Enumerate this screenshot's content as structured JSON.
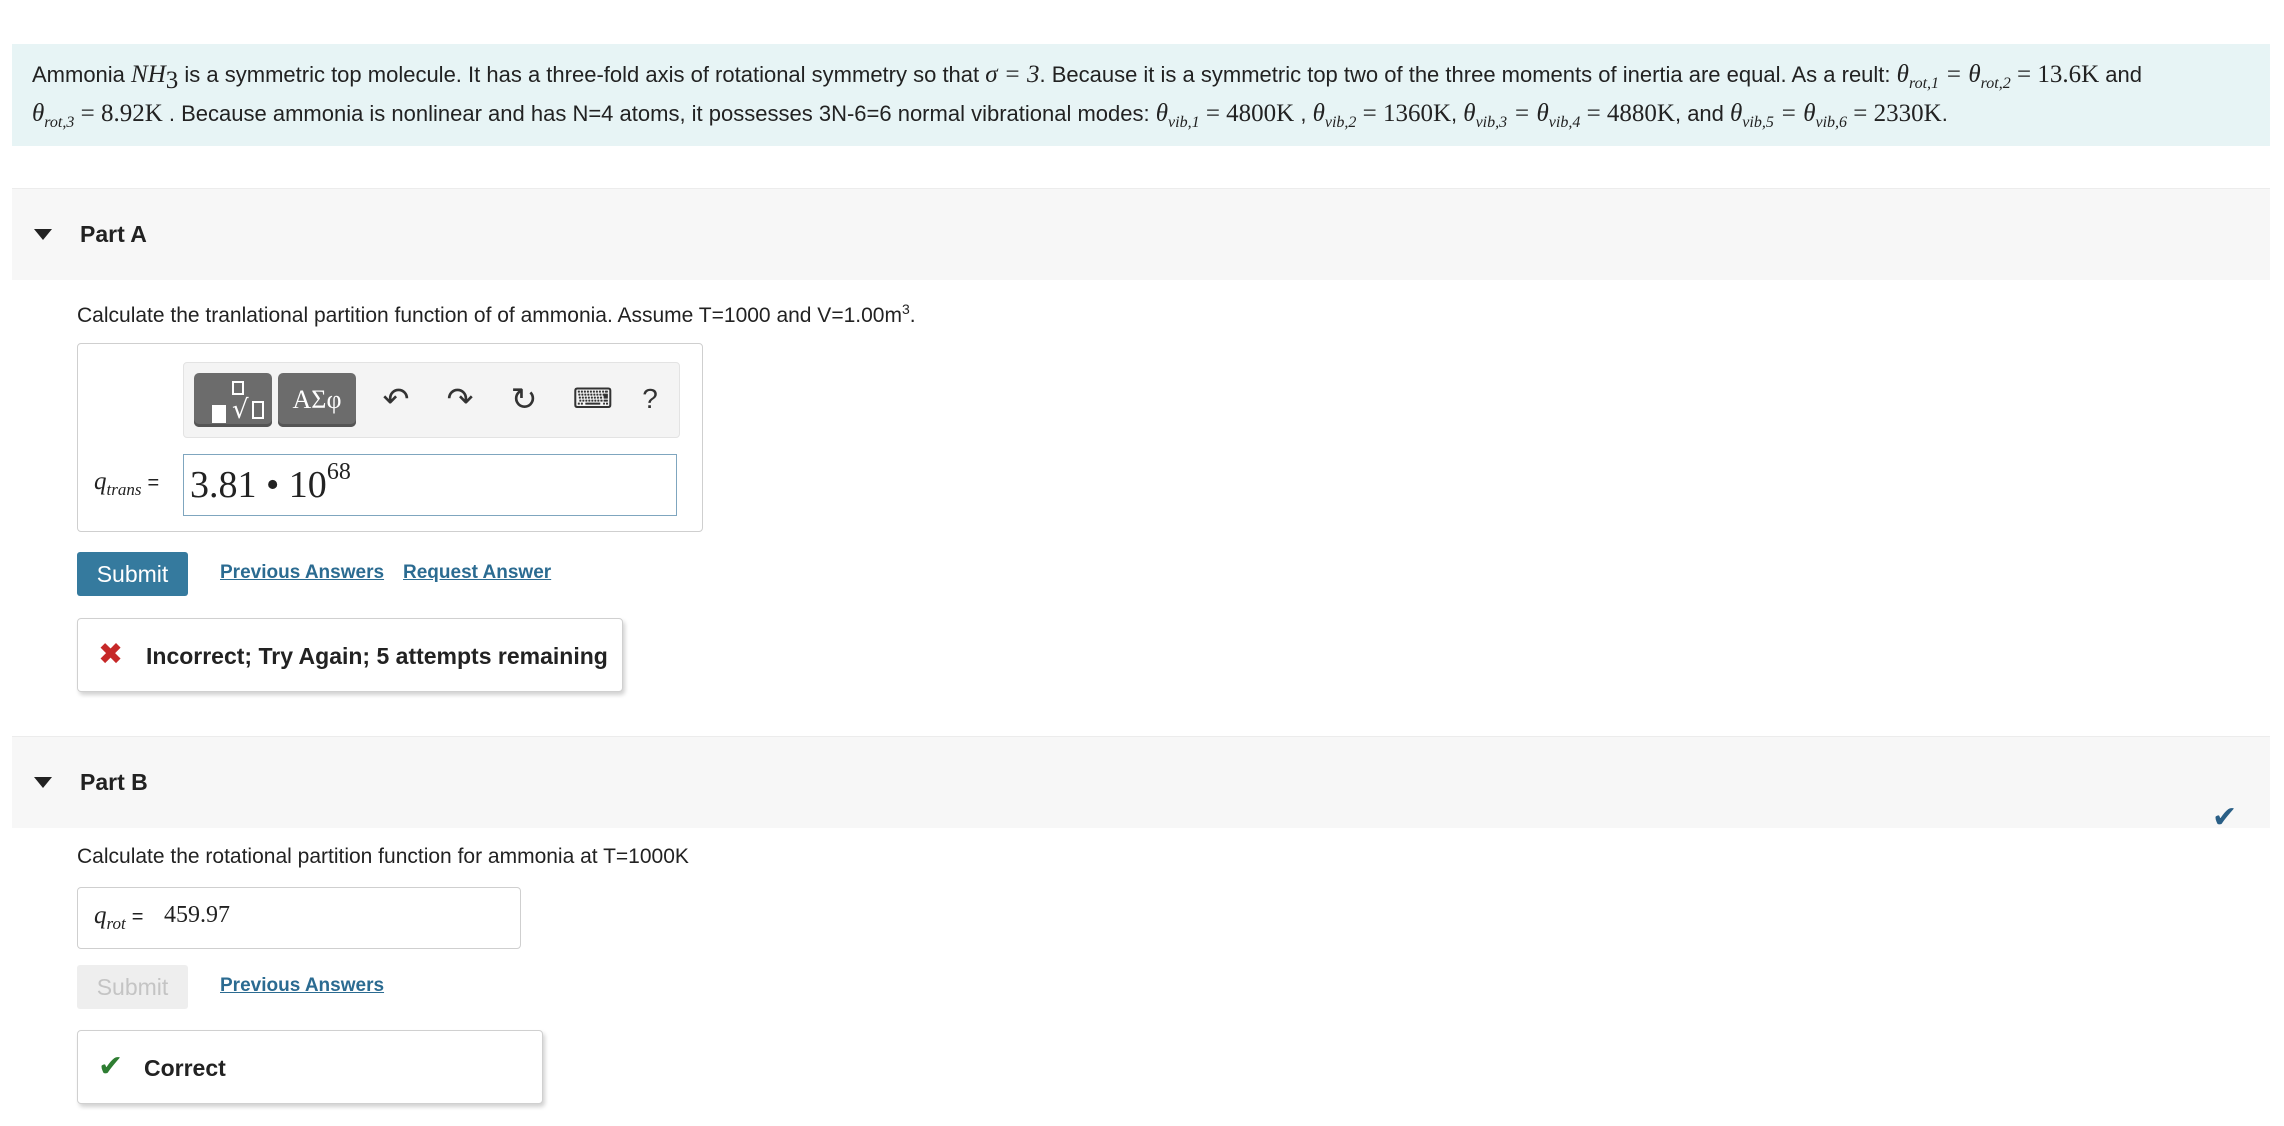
{
  "intro": {
    "t1": "Ammonia ",
    "nh": "NH",
    "nh_sub": "3",
    "t2": " is a symmetric top molecule. It has a three-fold axis of rotational symmetry so that ",
    "sigma": "σ = 3",
    "t3": ". Because it is a symmetric top two of the three moments of inertia are equal. As a reult: ",
    "rot12_a": "θ",
    "rot12_a_sub": "rot,1",
    "rot12_b": " = θ",
    "rot12_b_sub": "rot,2",
    "rot12_val": " = 13.6K",
    "t4": " and",
    "rot3": "θ",
    "rot3_sub": "rot,3",
    "rot3_val": " = 8.92K",
    "t5": " . Because ammonia is nonlinear and has N=4 atoms, it possesses 3N-6=6 normal vibrational modes: ",
    "v1": "θ",
    "v1_sub": "vib,1",
    "v1_val": " = 4800K",
    "t6": " , ",
    "v2": "θ",
    "v2_sub": "vib,2",
    "v2_val": " = 1360K",
    "t7": ", ",
    "v34_a": "θ",
    "v34_a_sub": "vib,3",
    "v34_b": " = θ",
    "v34_b_sub": "vib,4",
    "v34_val": " = 4880K",
    "t8": ", and ",
    "v56_a": "θ",
    "v56_a_sub": "vib,5",
    "v56_b": " = θ",
    "v56_b_sub": "vib,6",
    "v56_val": " = 2330K",
    "t9": "."
  },
  "part_a": {
    "title": "Part A",
    "question": "Calculate the tranlational partition function of  of ammonia. Assume T=1000 and V=1.00m",
    "question_sup": "3",
    "question_end": ".",
    "toolbar": {
      "symbols_label": "ΑΣφ",
      "undo_icon": "↶",
      "redo_icon": "↷",
      "reset_icon": "↻",
      "keyboard_icon": "⌨",
      "help_label": "?"
    },
    "var_symbol": "q",
    "var_sub": "trans",
    "var_eq": "=",
    "answer_mantissa": "3.81 • 10",
    "answer_exp": "68",
    "submit_label": "Submit",
    "prev_answers": "Previous Answers",
    "request_answer": "Request Answer",
    "feedback_icon": "✖",
    "feedback_text": "Incorrect; Try Again; 5 attempts remaining",
    "feedback_color": "#c62828"
  },
  "part_b": {
    "title": "Part B",
    "question": "Calculate the rotational partition function for ammonia at T=1000K",
    "var_symbol": "q",
    "var_sub": "rot",
    "var_eq": "=",
    "answer_value": "459.97",
    "submit_label": "Submit",
    "prev_answers": "Previous Answers",
    "feedback_icon": "✔",
    "feedback_text": "Correct",
    "feedback_color": "#2e7d32",
    "complete_icon": "✔"
  }
}
